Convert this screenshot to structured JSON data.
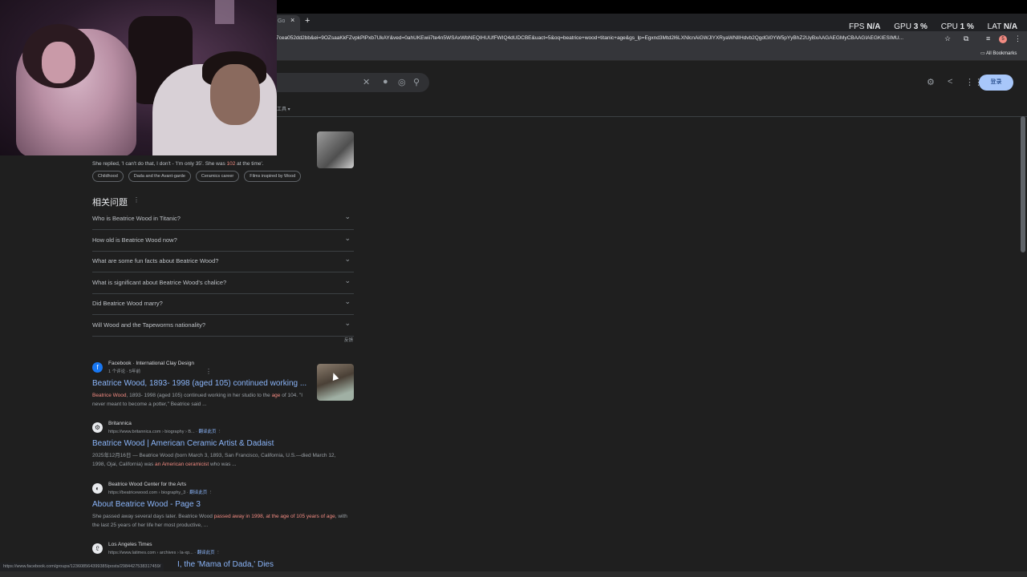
{
  "perf": {
    "fps_label": "FPS",
    "fps_value": "N/A",
    "gpu_label": "GPU",
    "gpu_value": "3 %",
    "cpu_label": "CPU",
    "cpu_value": "1 %",
    "lat_label": "LAT",
    "lat_value": "N/A"
  },
  "browser": {
    "tab_title": "Go",
    "url": "7cea052dd2bb&ei=9OZsaaKkFZvpkPlPxb7UkAY&ved=0ahUKEwii7te4n5WSAxWbNEQIHUUfFWIQ4dUDCBE&uact=5&oq=beatrice+wood+titanic+age&gs_lp=Egxnd3Mtd2l6LXNlcnAiGWJlYXRyaWNlIHdvb2QgdGl0YW5pYyBhZ2UyBxAAGAEGMyCBAAGIAEGKIESIMU...",
    "all_bookmarks": "All Bookmarks",
    "signin_label": "登录",
    "tools_hint": "工具 ▾"
  },
  "snippet": {
    "text_a": "She replied, 'I can't do that, I don't - 'I'm only 35'. She was ",
    "text_hl": "102",
    "text_b": " at the time'."
  },
  "chips": [
    "Childhood",
    "Dada and the Avant-garde",
    "Ceramics career",
    "Films inspired by Wood"
  ],
  "paa": {
    "title": "相关问题",
    "questions": [
      "Who is Beatrice Wood in Titanic?",
      "How old is Beatrice Wood now?",
      "What are some fun facts about Beatrice Wood?",
      "What is significant about Beatrice Wood's chalice?",
      "Did Beatrice Wood marry?",
      "Will Wood and the Tapeworms nationality?"
    ],
    "feedback": "反馈"
  },
  "results": [
    {
      "source": "Facebook · International Clay Design",
      "meta": "1 个评论 · 5年前",
      "title": "Beatrice Wood, 1893- 1998 (aged 105) continued working ...",
      "snip_hl1": "Beatrice Wood",
      "snip_a": ", 1893- 1998 (aged 105) continued working in her studio to the ",
      "snip_hl2": "age",
      "snip_b": " of 104. \"I never meant to become a potter,\" Beatrice said ..."
    },
    {
      "source": "Britannica",
      "meta": "https://www.britannica.com › biography › B...",
      "translate": "翻译此页",
      "title": "Beatrice Wood | American Ceramic Artist & Dadaist",
      "snip_a": "2025年12月16日 — Beatrice Wood (born March 3, 1893, San Francisco, California, U.S.—died March 12, 1998, Ojai, California) was ",
      "snip_hl1": "an American ceramicist",
      "snip_b": " who was ..."
    },
    {
      "source": "Beatrice Wood Center for the Arts",
      "meta": "https://beatricewood.com › biography_3",
      "translate": "翻译此页",
      "title": "About Beatrice Wood - Page 3",
      "snip_a": "She passed away several days later. Beatrice Wood ",
      "snip_hl1": "passed away in 1998, at the age of 105 years of age",
      "snip_b": ", with the last 25 years of her life her most productive, ..."
    },
    {
      "source": "Los Angeles Times",
      "meta": "https://www.latimes.com › archives › la-xp...",
      "translate": "翻译此页",
      "title": "I, the 'Mama of Dada,' Dies"
    }
  ],
  "status_url": "https://www.facebook.com/groups/123608564399385/posts/2984427538317459/"
}
